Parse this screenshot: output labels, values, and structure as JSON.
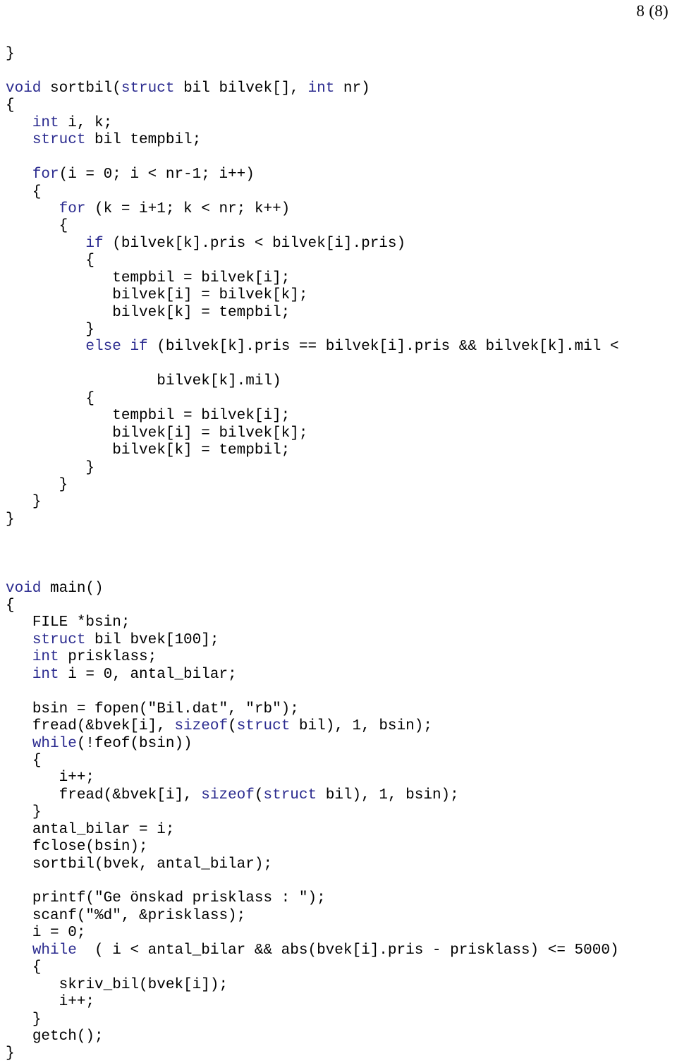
{
  "page": {
    "number_label": "8 (8)",
    "current": 8,
    "total": 8,
    "language": "c",
    "colors": {
      "background": "#ffffff",
      "text": "#000000",
      "keyword": "#2B2B8F"
    }
  },
  "code": {
    "language": "C",
    "keywords": [
      "void",
      "int",
      "struct",
      "for",
      "if",
      "else",
      "while",
      "sizeof"
    ],
    "lines": [
      {
        "indent": 0,
        "tokens": [
          {
            "t": "}",
            "k": false
          }
        ]
      },
      {
        "indent": 0,
        "tokens": []
      },
      {
        "indent": 0,
        "tokens": [
          {
            "t": "void",
            "k": true
          },
          {
            "t": " sortbil(",
            "k": false
          },
          {
            "t": "struct",
            "k": true
          },
          {
            "t": " bil bilvek[], ",
            "k": false
          },
          {
            "t": "int",
            "k": true
          },
          {
            "t": " nr)",
            "k": false
          }
        ]
      },
      {
        "indent": 0,
        "tokens": [
          {
            "t": "{",
            "k": false
          }
        ]
      },
      {
        "indent": 3,
        "tokens": [
          {
            "t": "int",
            "k": true
          },
          {
            "t": " i, k;",
            "k": false
          }
        ]
      },
      {
        "indent": 3,
        "tokens": [
          {
            "t": "struct",
            "k": true
          },
          {
            "t": " bil tempbil;",
            "k": false
          }
        ]
      },
      {
        "indent": 0,
        "tokens": []
      },
      {
        "indent": 3,
        "tokens": [
          {
            "t": "for",
            "k": true
          },
          {
            "t": "(i = 0; i < nr-1; i++)",
            "k": false
          }
        ]
      },
      {
        "indent": 3,
        "tokens": [
          {
            "t": "{",
            "k": false
          }
        ]
      },
      {
        "indent": 6,
        "tokens": [
          {
            "t": "for",
            "k": true
          },
          {
            "t": " (k = i+1; k < nr; k++)",
            "k": false
          }
        ]
      },
      {
        "indent": 6,
        "tokens": [
          {
            "t": "{",
            "k": false
          }
        ]
      },
      {
        "indent": 9,
        "tokens": [
          {
            "t": "if",
            "k": true
          },
          {
            "t": " (bilvek[k].pris < bilvek[i].pris)",
            "k": false
          }
        ]
      },
      {
        "indent": 9,
        "tokens": [
          {
            "t": "{",
            "k": false
          }
        ]
      },
      {
        "indent": 12,
        "tokens": [
          {
            "t": "tempbil = bilvek[i];",
            "k": false
          }
        ]
      },
      {
        "indent": 12,
        "tokens": [
          {
            "t": "bilvek[i] = bilvek[k];",
            "k": false
          }
        ]
      },
      {
        "indent": 12,
        "tokens": [
          {
            "t": "bilvek[k] = tempbil;",
            "k": false
          }
        ]
      },
      {
        "indent": 9,
        "tokens": [
          {
            "t": "}",
            "k": false
          }
        ]
      },
      {
        "indent": 9,
        "tokens": [
          {
            "t": "else",
            "k": true
          },
          {
            "t": " ",
            "k": false
          },
          {
            "t": "if",
            "k": true
          },
          {
            "t": " (bilvek[k].pris == bilvek[i].pris && bilvek[k].mil <",
            "k": false
          }
        ]
      },
      {
        "indent": 0,
        "tokens": []
      },
      {
        "indent": 17,
        "tokens": [
          {
            "t": "bilvek[k].mil)",
            "k": false
          }
        ]
      },
      {
        "indent": 9,
        "tokens": [
          {
            "t": "{",
            "k": false
          }
        ]
      },
      {
        "indent": 12,
        "tokens": [
          {
            "t": "tempbil = bilvek[i];",
            "k": false
          }
        ]
      },
      {
        "indent": 12,
        "tokens": [
          {
            "t": "bilvek[i] = bilvek[k];",
            "k": false
          }
        ]
      },
      {
        "indent": 12,
        "tokens": [
          {
            "t": "bilvek[k] = tempbil;",
            "k": false
          }
        ]
      },
      {
        "indent": 9,
        "tokens": [
          {
            "t": "}",
            "k": false
          }
        ]
      },
      {
        "indent": 6,
        "tokens": [
          {
            "t": "}",
            "k": false
          }
        ]
      },
      {
        "indent": 3,
        "tokens": [
          {
            "t": "}",
            "k": false
          }
        ]
      },
      {
        "indent": 0,
        "tokens": [
          {
            "t": "}",
            "k": false
          }
        ]
      },
      {
        "indent": 0,
        "tokens": []
      },
      {
        "indent": 0,
        "tokens": []
      },
      {
        "indent": 0,
        "tokens": []
      },
      {
        "indent": 0,
        "tokens": [
          {
            "t": "void",
            "k": true
          },
          {
            "t": " main()",
            "k": false
          }
        ]
      },
      {
        "indent": 0,
        "tokens": [
          {
            "t": "{",
            "k": false
          }
        ]
      },
      {
        "indent": 3,
        "tokens": [
          {
            "t": "FILE *bsin;",
            "k": false
          }
        ]
      },
      {
        "indent": 3,
        "tokens": [
          {
            "t": "struct",
            "k": true
          },
          {
            "t": " bil bvek[100];",
            "k": false
          }
        ]
      },
      {
        "indent": 3,
        "tokens": [
          {
            "t": "int",
            "k": true
          },
          {
            "t": " prisklass;",
            "k": false
          }
        ]
      },
      {
        "indent": 3,
        "tokens": [
          {
            "t": "int",
            "k": true
          },
          {
            "t": " i = 0, antal_bilar;",
            "k": false
          }
        ]
      },
      {
        "indent": 0,
        "tokens": []
      },
      {
        "indent": 3,
        "tokens": [
          {
            "t": "bsin = fopen(\"Bil.dat\", \"rb\");",
            "k": false
          }
        ]
      },
      {
        "indent": 3,
        "tokens": [
          {
            "t": "fread(&bvek[i], ",
            "k": false
          },
          {
            "t": "sizeof",
            "k": true
          },
          {
            "t": "(",
            "k": false
          },
          {
            "t": "struct",
            "k": true
          },
          {
            "t": " bil), 1, bsin);",
            "k": false
          }
        ]
      },
      {
        "indent": 3,
        "tokens": [
          {
            "t": "while",
            "k": true
          },
          {
            "t": "(!feof(bsin))",
            "k": false
          }
        ]
      },
      {
        "indent": 3,
        "tokens": [
          {
            "t": "{",
            "k": false
          }
        ]
      },
      {
        "indent": 6,
        "tokens": [
          {
            "t": "i++;",
            "k": false
          }
        ]
      },
      {
        "indent": 6,
        "tokens": [
          {
            "t": "fread(&bvek[i], ",
            "k": false
          },
          {
            "t": "sizeof",
            "k": true
          },
          {
            "t": "(",
            "k": false
          },
          {
            "t": "struct",
            "k": true
          },
          {
            "t": " bil), 1, bsin);",
            "k": false
          }
        ]
      },
      {
        "indent": 3,
        "tokens": [
          {
            "t": "}",
            "k": false
          }
        ]
      },
      {
        "indent": 3,
        "tokens": [
          {
            "t": "antal_bilar = i;",
            "k": false
          }
        ]
      },
      {
        "indent": 3,
        "tokens": [
          {
            "t": "fclose(bsin);",
            "k": false
          }
        ]
      },
      {
        "indent": 3,
        "tokens": [
          {
            "t": "sortbil(bvek, antal_bilar);",
            "k": false
          }
        ]
      },
      {
        "indent": 0,
        "tokens": []
      },
      {
        "indent": 3,
        "tokens": [
          {
            "t": "printf(\"Ge önskad prisklass : \");",
            "k": false
          }
        ]
      },
      {
        "indent": 3,
        "tokens": [
          {
            "t": "scanf(\"%d\", &prisklass);",
            "k": false
          }
        ]
      },
      {
        "indent": 3,
        "tokens": [
          {
            "t": "i = 0;",
            "k": false
          }
        ]
      },
      {
        "indent": 3,
        "tokens": [
          {
            "t": "while",
            "k": true
          },
          {
            "t": "  ( i < antal_bilar && abs(bvek[i].pris - prisklass) <= 5000)",
            "k": false
          }
        ]
      },
      {
        "indent": 3,
        "tokens": [
          {
            "t": "{",
            "k": false
          }
        ]
      },
      {
        "indent": 6,
        "tokens": [
          {
            "t": "skriv_bil(bvek[i]);",
            "k": false
          }
        ]
      },
      {
        "indent": 6,
        "tokens": [
          {
            "t": "i++;",
            "k": false
          }
        ]
      },
      {
        "indent": 3,
        "tokens": [
          {
            "t": "}",
            "k": false
          }
        ]
      },
      {
        "indent": 3,
        "tokens": [
          {
            "t": "getch();",
            "k": false
          }
        ]
      },
      {
        "indent": 0,
        "tokens": [
          {
            "t": "}",
            "k": false
          }
        ]
      }
    ]
  }
}
